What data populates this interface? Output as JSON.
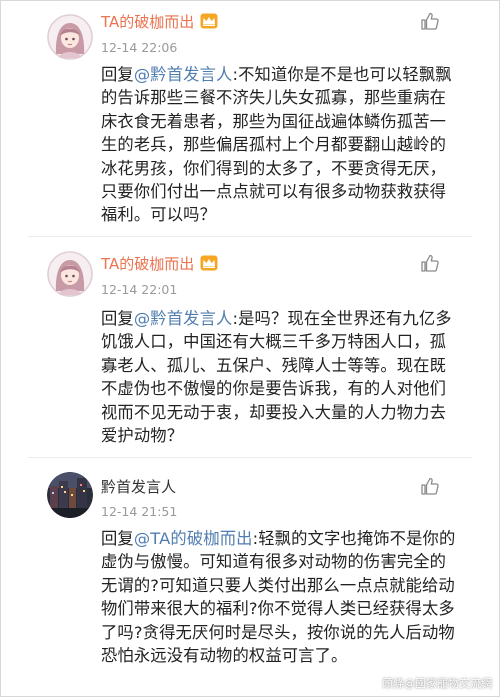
{
  "comments": [
    {
      "author": "TA的破枷而出",
      "author_color": "#eb7350",
      "badge_icon": "member-crown-badge-icon",
      "time": "12-14 22:06",
      "reply_prefix": "回复",
      "mention": "@黔首发言人",
      "body": ":不知道你是不是也可以轻飘飘的告诉那些三餐不济失儿失女孤寡，那些重病在床衣食无着患者，那些为国征战遍体鳞伤孤苦一生的老兵，那些偏居孤村上个月都要翻山越岭的冰花男孩，你们得到的太多了，不要贪得无厌，只要你们付出一点点就可以有很多动物获救获得福利。可以吗？"
    },
    {
      "author": "TA的破枷而出",
      "author_color": "#eb7350",
      "badge_icon": "member-crown-badge-icon",
      "time": "12-14 22:01",
      "reply_prefix": "回复",
      "mention": "@黔首发言人",
      "body": ":是吗？现在全世界还有九亿多饥饿人口，中国还有大概三千多万特困人口，孤寡老人、孤儿、五保户、残障人士等等。现在既不虚伪也不傲慢的你是要告诉我，有的人对他们视而不见无动于衷，却要投入大量的人力物力去爱护动物？"
    },
    {
      "author": "黔首发言人",
      "author_color": "#333333",
      "badge_icon": "",
      "time": "12-14 21:51",
      "reply_prefix": "回复",
      "mention": "@TA的破枷而出",
      "body": ":轻飘的文字也掩饰不是你的虚伪与傲慢。可知道有很多对动物的伤害完全的无谓的?可知道只要人类付出那么一点点就能给动物们带来很大的福利?你不觉得人类已经获得太多了吗?贪得无厌何时是尽头，按你说的先人后动物恐怕永远没有动物的权益可言了。"
    }
  ],
  "like_icon": "thumbs-up-icon",
  "watermark": "頭條@國家寵物交流網"
}
